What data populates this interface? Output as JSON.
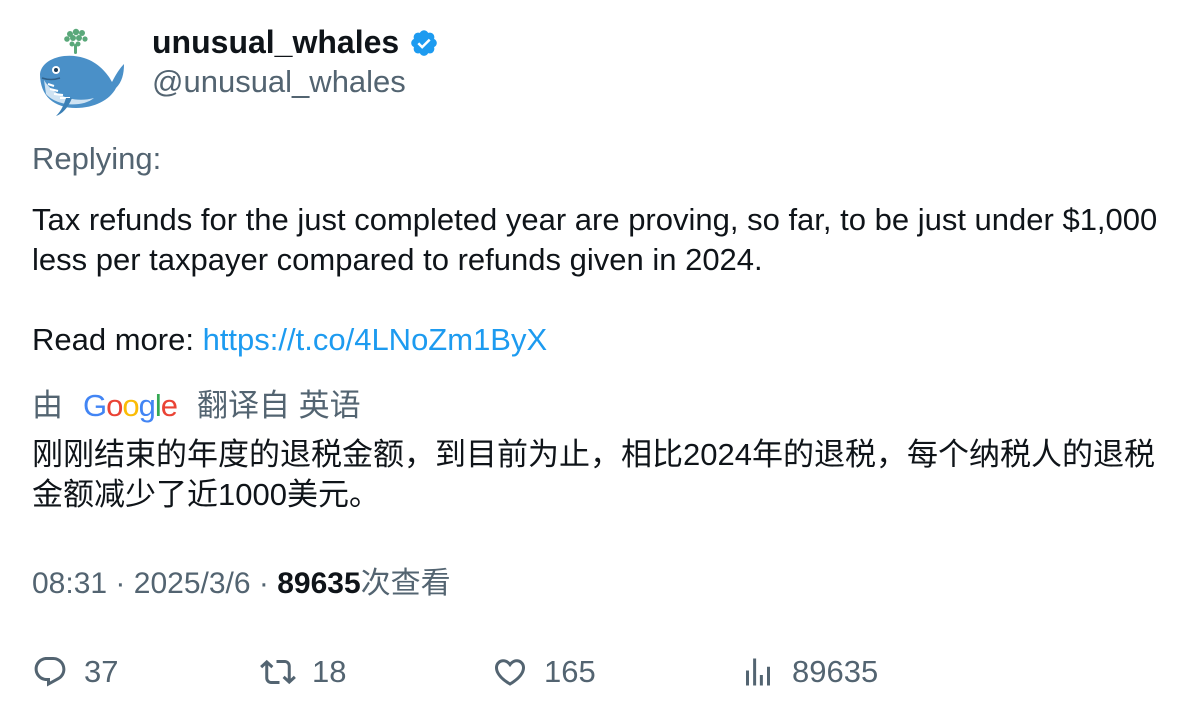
{
  "author": {
    "display_name": "unusual_whales",
    "handle": "@unusual_whales",
    "verified": true,
    "avatar_icon": "whale-logo-icon"
  },
  "replying_label": "Replying:",
  "tweet": {
    "text_line1": "Tax refunds for the just completed year are proving, so far, to be just under $1,000 less per taxpayer compared to refunds given in 2024.",
    "read_more_label": "Read more: ",
    "link": "https://t.co/4LNoZm1ByX"
  },
  "translation": {
    "by_label": "由",
    "provider": "Google",
    "from_label": "翻译自 英语",
    "text": "刚刚结束的年度的退税金额，到目前为止，相比2024年的退税，每个纳税人的退税金额减少了近1000美元。"
  },
  "meta": {
    "time": "08:31",
    "separator": "·",
    "date": "2025/3/6",
    "views_count": "89635",
    "views_label": "次查看"
  },
  "actions": {
    "replies": "37",
    "retweets": "18",
    "likes": "165",
    "views": "89635"
  },
  "colors": {
    "accent": "#1d9bf0",
    "secondary_text": "#536471",
    "primary_text": "#0f1419"
  }
}
